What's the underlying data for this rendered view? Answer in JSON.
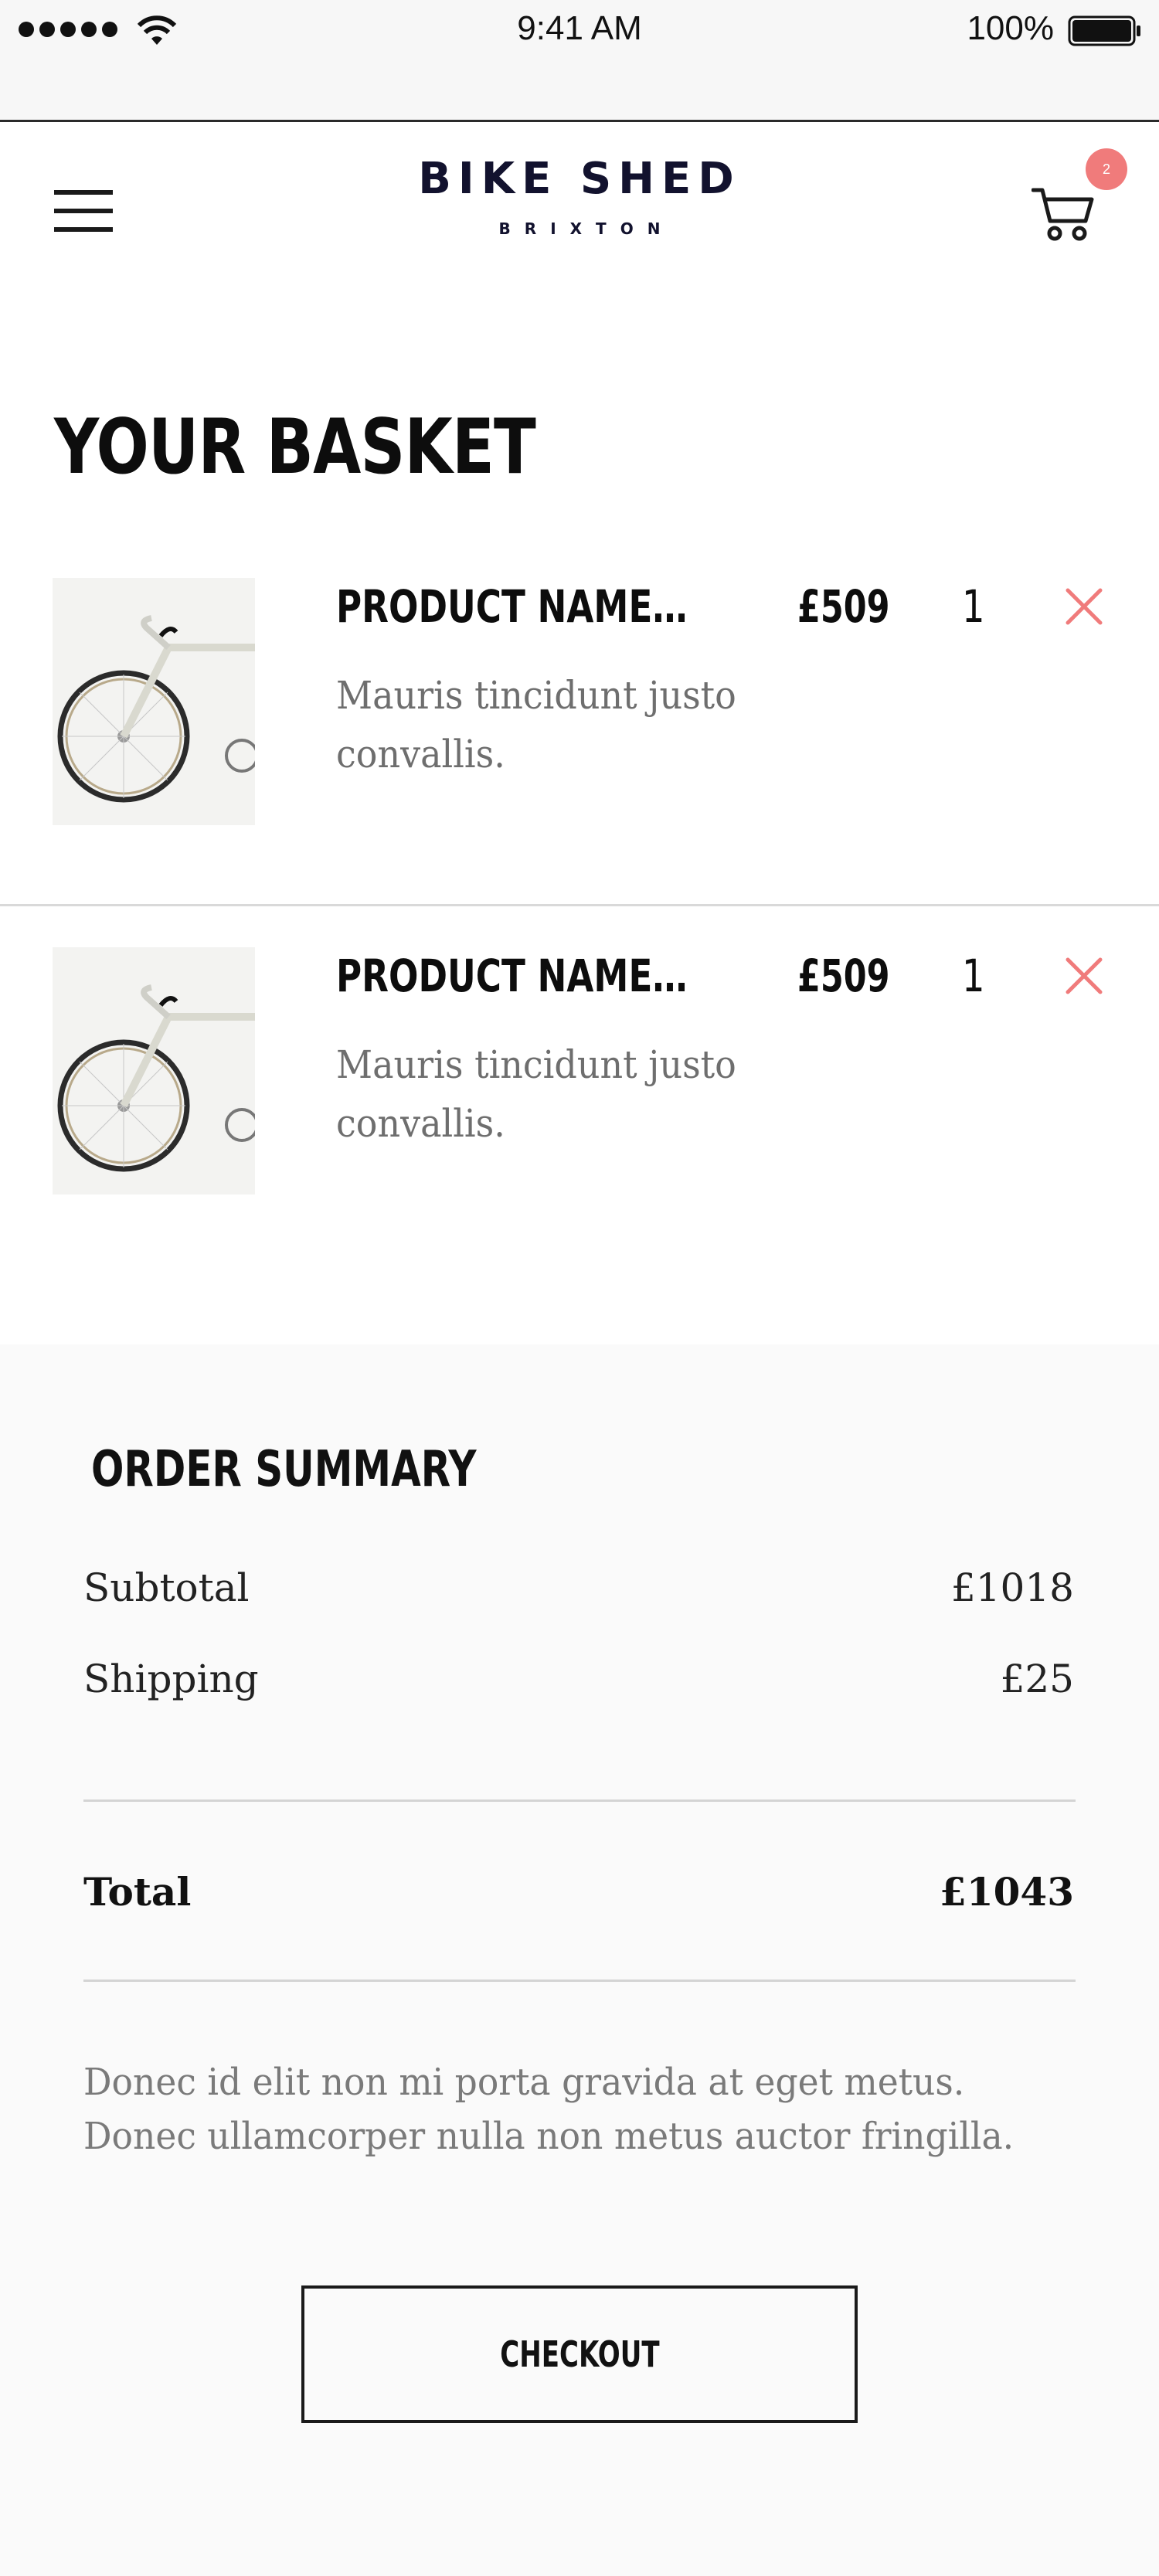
{
  "status_bar": {
    "time": "9:41 AM",
    "battery": "100%",
    "icons": [
      "signal-icon",
      "wifi-icon",
      "battery-icon"
    ]
  },
  "header": {
    "logo_title": "BIKE SHED",
    "logo_subtitle": "BRIXTON",
    "cart_count": "2",
    "icons": [
      "menu-icon",
      "cart-icon"
    ]
  },
  "basket": {
    "title": "YOUR BASKET",
    "items": [
      {
        "name": "PRODUCT NAME…",
        "description": "Mauris tincidunt justo convallis.",
        "price": "£509",
        "quantity": "1"
      },
      {
        "name": "PRODUCT NAME…",
        "description": "Mauris tincidunt justo convallis.",
        "price": "£509",
        "quantity": "1"
      }
    ]
  },
  "summary": {
    "title": "ORDER SUMMARY",
    "subtotal_label": "Subtotal",
    "subtotal_value": "£1018",
    "shipping_label": "Shipping",
    "shipping_value": "£25",
    "total_label": "Total",
    "total_value": "£1043",
    "note": "Donec id elit non mi porta gravida at eget metus. Donec ullamcorper nulla non metus auctor fringilla.",
    "checkout_label": "CHECKOUT"
  },
  "colors": {
    "accent_remove": "#f07b7b",
    "badge": "#f07b7b",
    "logo": "#12122e",
    "summary_background": "#fafafa"
  }
}
